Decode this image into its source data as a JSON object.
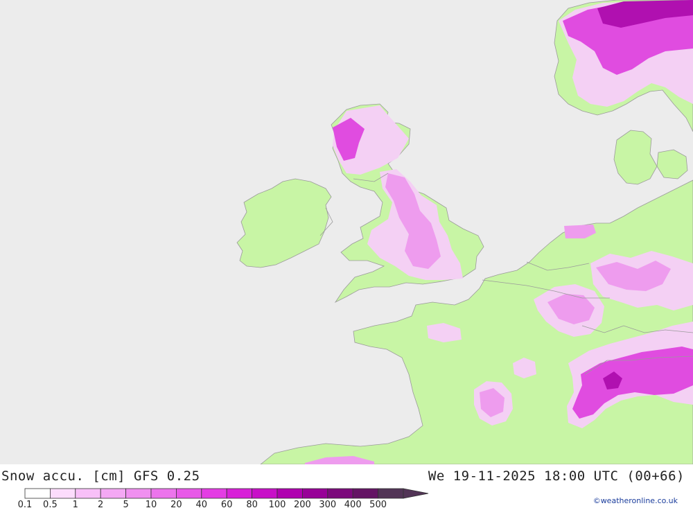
{
  "header": {
    "product": "Snow accu. [cm] GFS 0.25",
    "valid_time": "We 19-11-2025 18:00 UTC (00+66)"
  },
  "credit": "©weatheronline.co.uk",
  "legend": {
    "labels": [
      "0.1",
      "0.5",
      "1",
      "2",
      "5",
      "10",
      "20",
      "40",
      "60",
      "80",
      "100",
      "200",
      "300",
      "400",
      "500"
    ],
    "colors": [
      "#ffffff",
      "#fcdcfc",
      "#f8c0f8",
      "#f4a8f4",
      "#f090f0",
      "#ec74ec",
      "#e858e8",
      "#e43ce4",
      "#d820d8",
      "#c810c8",
      "#b000b0",
      "#980098",
      "#7c0a7c",
      "#641464",
      "#523456"
    ]
  },
  "map": {
    "sea_color": "#ececec",
    "land_color": "#c8f5a5",
    "border_color": "#9a9a9a",
    "snow_light_color": "#f4d0f4",
    "snow_mid_color": "#ee9cee",
    "snow_strong_color": "#e04ce0",
    "snow_peak_color": "#b010b0"
  }
}
